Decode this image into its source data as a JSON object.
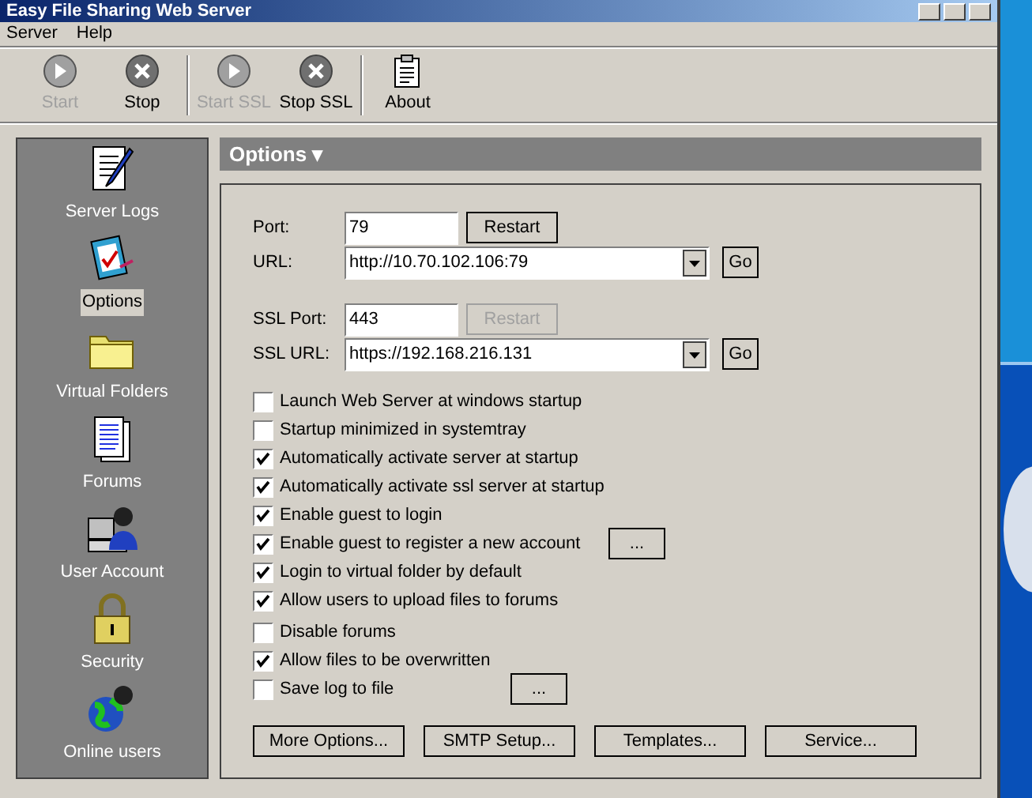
{
  "window": {
    "title": "Easy File Sharing Web Server"
  },
  "menu": [
    "Server",
    "Help"
  ],
  "toolbar": [
    {
      "label": "Start",
      "kind": "start",
      "disabled": true
    },
    {
      "label": "Stop",
      "kind": "stop",
      "disabled": false
    },
    {
      "label": "Start SSL",
      "kind": "start",
      "disabled": true,
      "separator_before": true
    },
    {
      "label": "Stop SSL",
      "kind": "stop",
      "disabled": false
    },
    {
      "label": "About",
      "kind": "about",
      "disabled": false,
      "separator_before": true
    }
  ],
  "sidebar": {
    "items": [
      {
        "label": "Server Logs",
        "kind": "log",
        "selected": false
      },
      {
        "label": "Options",
        "kind": "options",
        "selected": true
      },
      {
        "label": "Virtual Folders",
        "kind": "folder",
        "selected": false
      },
      {
        "label": "Forums",
        "kind": "forums",
        "selected": false
      },
      {
        "label": "User Account",
        "kind": "user",
        "selected": false
      },
      {
        "label": "Security",
        "kind": "security",
        "selected": false
      },
      {
        "label": "Online users",
        "kind": "online",
        "selected": false
      }
    ]
  },
  "panel": {
    "title": "Options ▾",
    "port": {
      "label": "Port:",
      "value": "79",
      "button": "Restart",
      "button_disabled": false
    },
    "url": {
      "label": "URL:",
      "value": "http://10.70.102.106:79",
      "button": "Go"
    },
    "ssl_port": {
      "label": "SSL Port:",
      "value": "443",
      "button": "Restart",
      "button_disabled": true
    },
    "ssl_url": {
      "label": "SSL URL:",
      "value": "https://192.168.216.131",
      "button": "Go"
    },
    "checkbox_groups": [
      [
        {
          "label": "Launch Web Server at windows startup",
          "checked": false
        },
        {
          "label": "Startup minimized in systemtray",
          "checked": false
        },
        {
          "label": "Automatically activate server at startup",
          "checked": true
        },
        {
          "label": "Automatically activate ssl server at startup",
          "checked": true
        },
        {
          "label": "Enable guest to login",
          "checked": true
        },
        {
          "label": "Enable guest to register a new account",
          "checked": true,
          "button": "..."
        },
        {
          "label": "Login to virtual folder by default",
          "checked": true
        },
        {
          "label": "Allow users to upload files to forums",
          "checked": true
        }
      ],
      [
        {
          "label": "Disable forums",
          "checked": false
        },
        {
          "label": "Allow files to be overwritten",
          "checked": true
        },
        {
          "label": "Save log to file",
          "checked": false,
          "button": "..."
        }
      ]
    ],
    "buttons": [
      "More Options...",
      "SMTP Setup...",
      "Templates...",
      "Service..."
    ]
  }
}
